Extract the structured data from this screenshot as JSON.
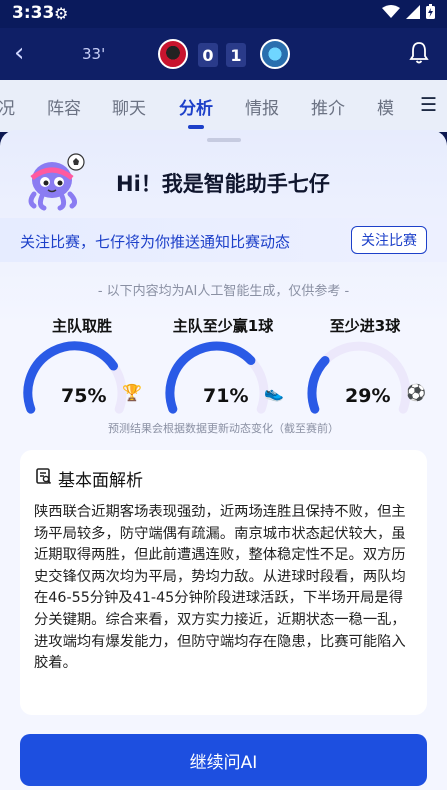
{
  "status_bar": {
    "time": "3:33",
    "icons": [
      "settings-icon",
      "wifi-icon",
      "signal-icon",
      "battery-icon"
    ]
  },
  "header": {
    "minute": "33'",
    "home_score": "0",
    "away_score": "1"
  },
  "tabs": [
    {
      "label": "况",
      "active": false
    },
    {
      "label": "阵容",
      "active": false
    },
    {
      "label": "聊天",
      "active": false
    },
    {
      "label": "分析",
      "active": true
    },
    {
      "label": "情报",
      "active": false
    },
    {
      "label": "推介",
      "active": false
    },
    {
      "label": "模",
      "active": false
    }
  ],
  "assistant": {
    "greeting": "Hi！我是智能助手七仔",
    "follow_text": "关注比赛，七仔将为你推送通知比赛动态",
    "follow_button": "关注比赛",
    "disclaimer": "- 以下内容均为AI人工智能生成，仅供参考 -"
  },
  "predictions": [
    {
      "title": "主队取胜",
      "percent": 75,
      "display": "75%",
      "icon": "trophy-icon"
    },
    {
      "title": "主队至少赢1球",
      "percent": 71,
      "display": "71%",
      "icon": "boot-icon"
    },
    {
      "title": "至少进3球",
      "percent": 29,
      "display": "29%",
      "icon": "soccer-ball-icon"
    }
  ],
  "prediction_note": "预测结果会根据数据更新动态变化（截至赛前）",
  "analysis": {
    "title": "基本面解析",
    "body": "陕西联合近期客场表现强劲，近两场连胜且保持不败，但主场平局较多，防守端偶有疏漏。南京城市状态起伏较大，虽近期取得两胜，但此前遭遇连败，整体稳定性不足。双方历史交锋仅两次均为平局，势均力敌。从进球时段看，两队均在46-55分钟及41-45分钟阶段进球活跃，下半场开局是得分关键期。综合来看，双方实力接近，近期状态一稳一乱，进攻端均有爆发能力，但防守端均存在隐患，比赛可能陷入胶着。"
  },
  "cta_label": "继续问AI",
  "colors": {
    "accent": "#1d40c9",
    "gauge_fill": "#2a5ae6",
    "gauge_track": "#ece8fb"
  }
}
